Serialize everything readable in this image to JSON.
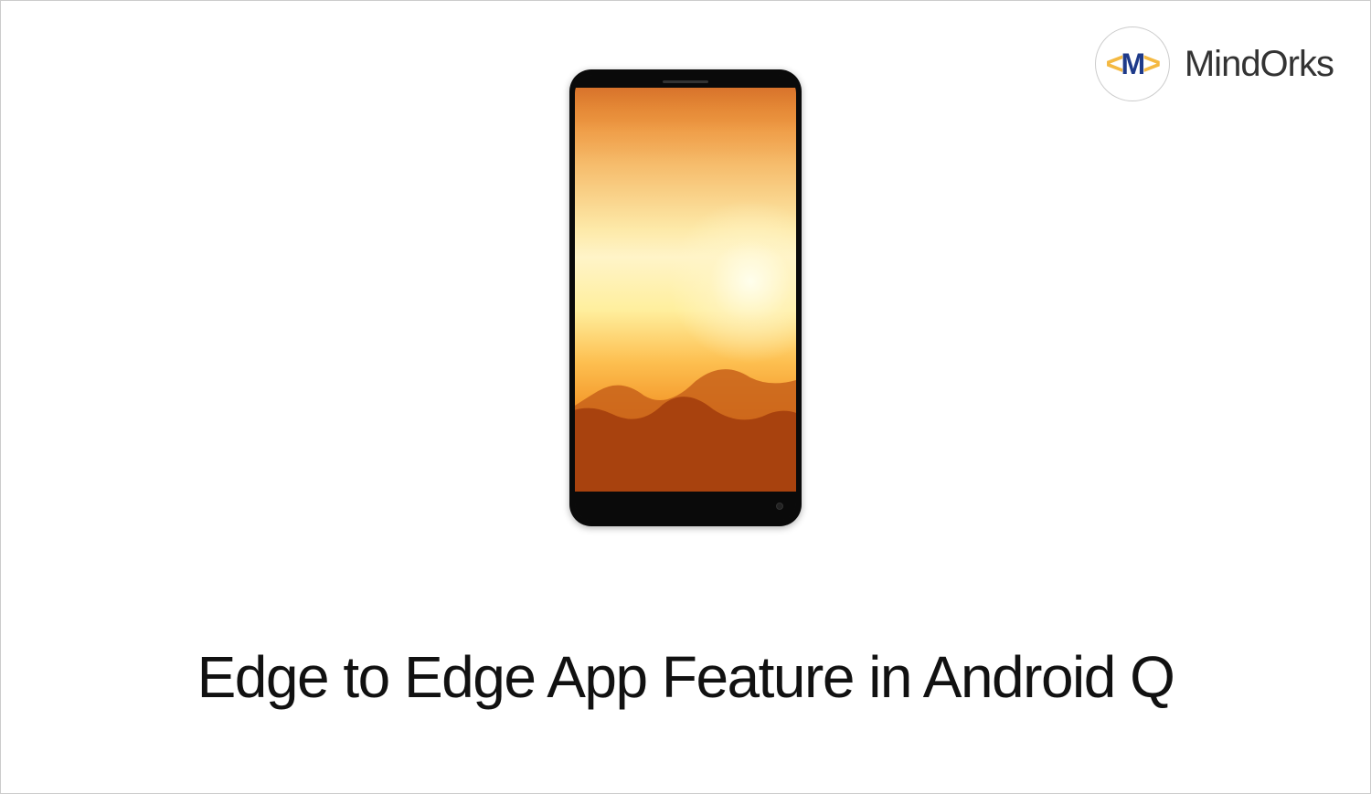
{
  "brand": {
    "name": "MindOrks",
    "logo_symbol": "M"
  },
  "title": "Edge to Edge App Feature in Android Q"
}
